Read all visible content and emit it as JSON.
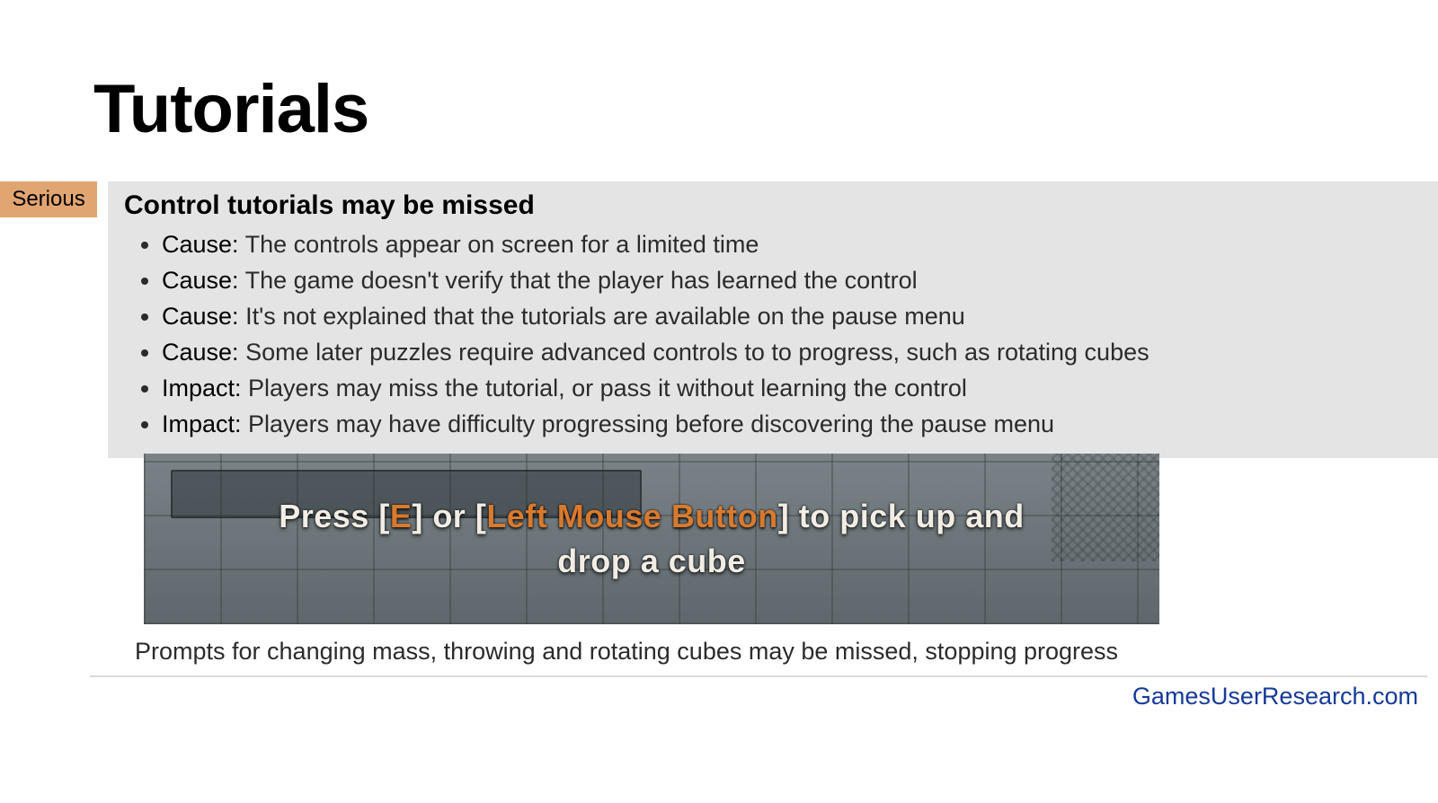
{
  "title": "Tutorials",
  "severity": "Serious",
  "issue_title": "Control tutorials may be missed",
  "points": [
    {
      "label": "Cause:",
      "text": " The controls appear on screen for a limited time"
    },
    {
      "label": "Cause:",
      "text": " The game doesn't verify that the player has learned the control"
    },
    {
      "label": "Cause:",
      "text": " It's not explained that the tutorials are available on the pause menu"
    },
    {
      "label": "Cause:",
      "text": " Some later puzzles require advanced controls to to progress, such as rotating cubes"
    },
    {
      "label": "Impact:",
      "text": " Players may miss the tutorial, or pass it without learning the control"
    },
    {
      "label": "Impact:",
      "text": " Players may have difficulty progressing before discovering the pause menu"
    }
  ],
  "prompt": {
    "pre": "Press [",
    "key1": "E",
    "mid1": "] or [",
    "key2": "Left Mouse Button",
    "mid2": "] to pick up and",
    "line2": "drop a cube"
  },
  "caption": "Prompts for changing mass, throwing and rotating cubes may be missed, stopping progress",
  "footer": "GamesUserResearch.com"
}
